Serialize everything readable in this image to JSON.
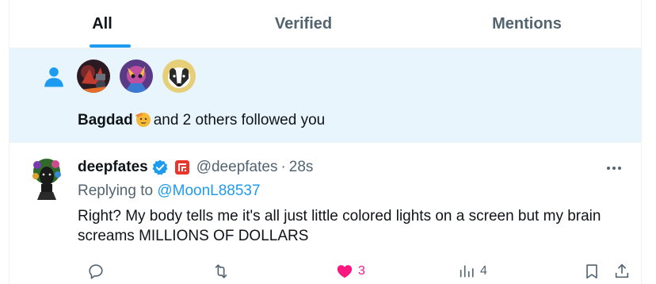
{
  "tabs": [
    {
      "label": "All",
      "active": true
    },
    {
      "label": "Verified",
      "active": false
    },
    {
      "label": "Mentions",
      "active": false
    }
  ],
  "notification": {
    "icon": "person-icon",
    "follower_name": "Bagdad",
    "rest_text": "and 2 others followed you",
    "avatars": [
      "follower-avatar-1",
      "follower-avatar-2",
      "badger-avatar"
    ]
  },
  "tweet": {
    "display_name": "deepfates",
    "handle": "@deepfates",
    "separator": "·",
    "time": "28s",
    "replying_prefix": "Replying to",
    "replying_to": "@MoonL88537",
    "text": "Right? My body tells me it's all just little colored lights on a screen but my brain screams MILLIONS OF DOLLARS",
    "actions": {
      "reply_count": "",
      "retweet_count": "",
      "like_count": "3",
      "views_count": "4"
    }
  },
  "colors": {
    "accent": "#1d9bf0",
    "like": "#f91880",
    "notification_bg": "#e8f5fd",
    "muted": "#536471"
  }
}
